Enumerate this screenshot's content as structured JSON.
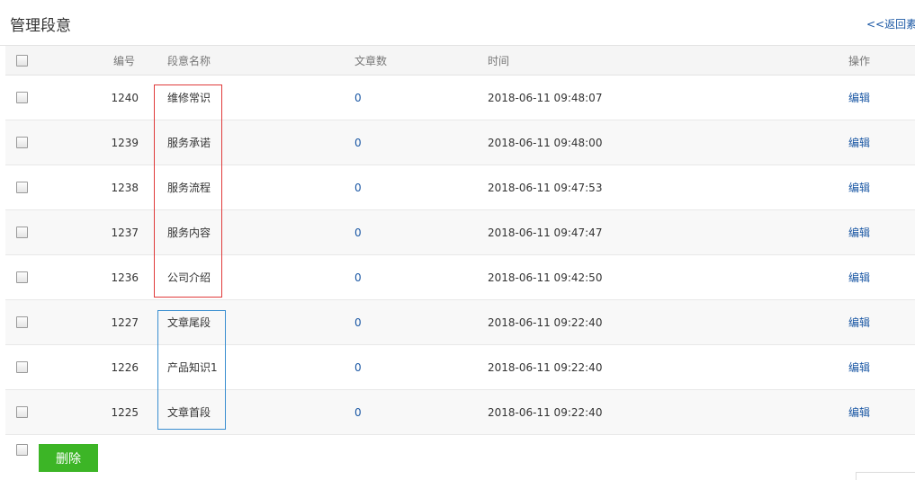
{
  "header": {
    "title": "管理段意",
    "back_link": "<<返回素材"
  },
  "table": {
    "columns": {
      "id": "编号",
      "name": "段意名称",
      "count": "文章数",
      "time": "时间",
      "op": "操作"
    },
    "rows": [
      {
        "id": "1240",
        "name": "维修常识",
        "count": "0",
        "time": "2018-06-11 09:48:07",
        "op": "编辑"
      },
      {
        "id": "1239",
        "name": "服务承诺",
        "count": "0",
        "time": "2018-06-11 09:48:00",
        "op": "编辑"
      },
      {
        "id": "1238",
        "name": "服务流程",
        "count": "0",
        "time": "2018-06-11 09:47:53",
        "op": "编辑"
      },
      {
        "id": "1237",
        "name": "服务内容",
        "count": "0",
        "time": "2018-06-11 09:47:47",
        "op": "编辑"
      },
      {
        "id": "1236",
        "name": "公司介绍",
        "count": "0",
        "time": "2018-06-11 09:42:50",
        "op": "编辑"
      },
      {
        "id": "1227",
        "name": "文章尾段",
        "count": "0",
        "time": "2018-06-11 09:22:40",
        "op": "编辑"
      },
      {
        "id": "1226",
        "name": "产品知识1",
        "count": "0",
        "time": "2018-06-11 09:22:40",
        "op": "编辑"
      },
      {
        "id": "1225",
        "name": "文章首段",
        "count": "0",
        "time": "2018-06-11 09:22:40",
        "op": "编辑"
      }
    ]
  },
  "footer": {
    "delete_label": "删除"
  },
  "colors": {
    "link": "#1a57a4",
    "delete_button": "#3cb526",
    "annotation_red": "#e03b3b",
    "annotation_blue": "#3a8fd0"
  }
}
